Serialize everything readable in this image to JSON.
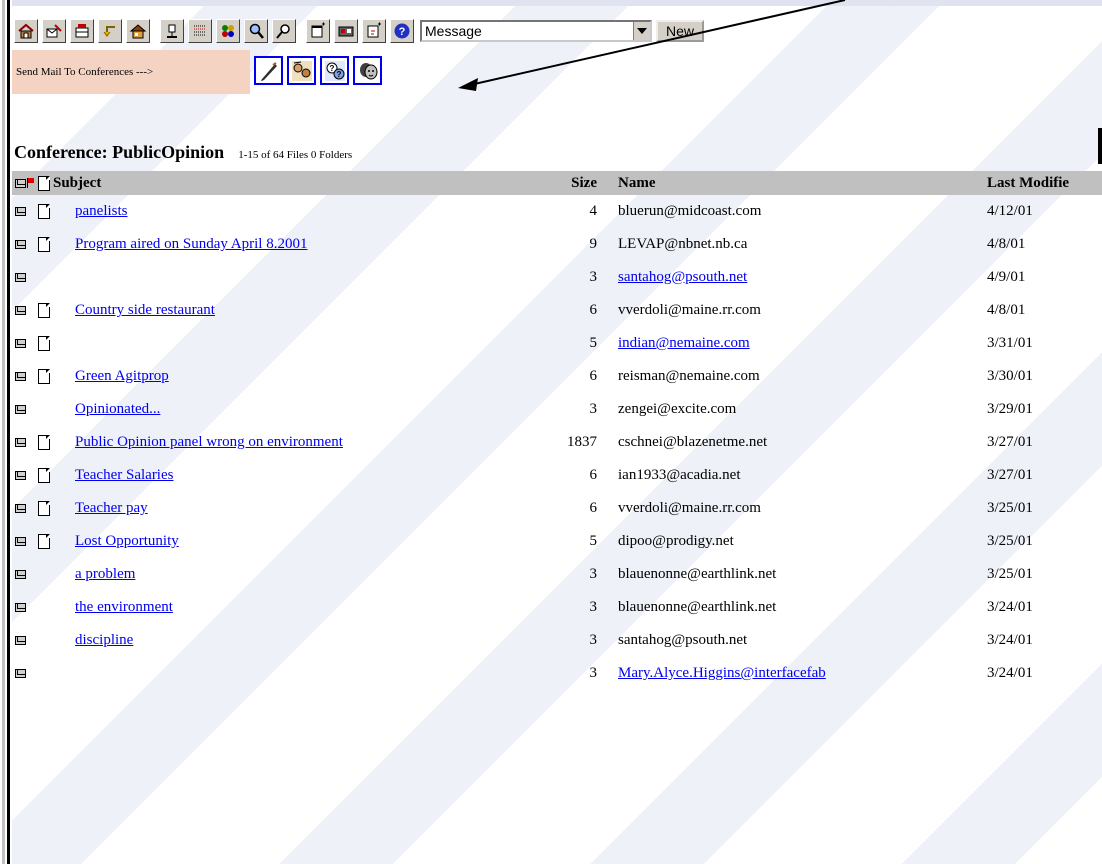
{
  "toolbar": {
    "icons": [
      "home-icon",
      "compose-icon",
      "mailbox-icon",
      "reply-icon",
      "folder-up-icon",
      "user-icon",
      "list-icon",
      "filter-icon",
      "search-icon",
      "find-icon",
      "new-window-icon",
      "print-icon",
      "edit-icon",
      "help-icon"
    ],
    "select_value": "Message",
    "new_label": "New"
  },
  "send_mail": {
    "label": "Send Mail To Conferences --->",
    "icons": [
      "pen-icon",
      "faces-icon",
      "question-icon",
      "masks-icon"
    ]
  },
  "conference": {
    "title": "Conference: PublicOpinion",
    "count": "1-15 of 64 Files   0 Folders"
  },
  "table": {
    "headers": {
      "subject": "Subject",
      "size": "Size",
      "name": "Name",
      "date": "Last Modifie"
    },
    "rows": [
      {
        "has_doc": true,
        "subject": "panelists",
        "size": "4",
        "name": "bluerun@midcoast.com",
        "name_link": false,
        "date": "4/12/01",
        "indent": false
      },
      {
        "has_doc": true,
        "subject": "Program aired on Sunday April 8.2001",
        "size": "9",
        "name": "LEVAP@nbnet.nb.ca",
        "name_link": false,
        "date": "4/8/01",
        "indent": false
      },
      {
        "has_doc": false,
        "subject": "",
        "size": "3",
        "name": "santahog@psouth.net",
        "name_link": true,
        "date": "4/9/01",
        "indent": false
      },
      {
        "has_doc": true,
        "subject": "Country side restaurant",
        "size": "6",
        "name": "vverdoli@maine.rr.com",
        "name_link": false,
        "date": "4/8/01",
        "indent": false
      },
      {
        "has_doc": true,
        "subject": "",
        "size": "5",
        "name": "indian@nemaine.com",
        "name_link": true,
        "date": "3/31/01",
        "indent": false
      },
      {
        "has_doc": true,
        "subject": "Green Agitprop",
        "size": "6",
        "name": "reisman@nemaine.com",
        "name_link": false,
        "date": "3/30/01",
        "indent": false
      },
      {
        "has_doc": false,
        "subject": "Opinionated...",
        "size": "3",
        "name": "zengei@excite.com",
        "name_link": false,
        "date": "3/29/01",
        "indent": true
      },
      {
        "has_doc": true,
        "subject": "Public Opinion panel wrong on environment",
        "size": "1837",
        "name": "cschnei@blazenetme.net",
        "name_link": false,
        "date": "3/27/01",
        "indent": false
      },
      {
        "has_doc": true,
        "subject": "Teacher Salaries",
        "size": "6",
        "name": "ian1933@acadia.net",
        "name_link": false,
        "date": "3/27/01",
        "indent": false
      },
      {
        "has_doc": true,
        "subject": "Teacher pay",
        "size": "6",
        "name": "vverdoli@maine.rr.com",
        "name_link": false,
        "date": "3/25/01",
        "indent": false
      },
      {
        "has_doc": true,
        "subject": "Lost Opportunity",
        "size": "5",
        "name": "dipoo@prodigy.net",
        "name_link": false,
        "date": "3/25/01",
        "indent": false
      },
      {
        "has_doc": false,
        "subject": "a problem",
        "size": "3",
        "name": "blauenonne@earthlink.net",
        "name_link": false,
        "date": "3/25/01",
        "indent": true
      },
      {
        "has_doc": false,
        "subject": "the environment",
        "size": "3",
        "name": "blauenonne@earthlink.net",
        "name_link": false,
        "date": "3/24/01",
        "indent": true
      },
      {
        "has_doc": false,
        "subject": "discipline",
        "size": "3",
        "name": "santahog@psouth.net",
        "name_link": false,
        "date": "3/24/01",
        "indent": true
      },
      {
        "has_doc": false,
        "subject": "",
        "size": "3",
        "name": "Mary.Alyce.Higgins@interfacefab",
        "name_link": true,
        "date": "3/24/01",
        "indent": false
      }
    ]
  },
  "colors": {
    "link": "#0000ee",
    "header_bg": "#c0c0c0",
    "sendmail_bg": "#f4d3c3"
  }
}
